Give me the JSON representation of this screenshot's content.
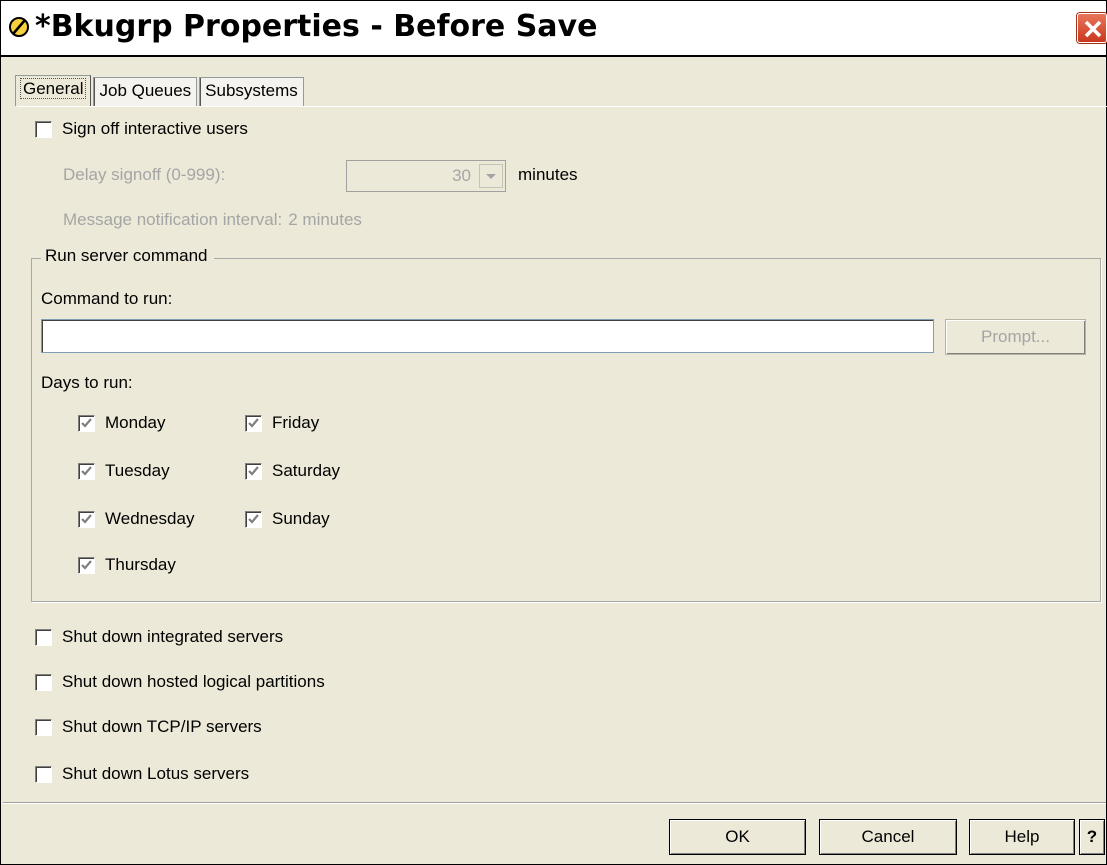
{
  "window": {
    "title": "*Bkugrp Properties - Before Save"
  },
  "tabs": [
    {
      "label": "General",
      "active": true
    },
    {
      "label": "Job Queues",
      "active": false
    },
    {
      "label": "Subsystems",
      "active": false
    }
  ],
  "general": {
    "sign_off": {
      "label": "Sign off interactive users",
      "checked": false
    },
    "delay_signoff": {
      "label": "Delay signoff (0-999):",
      "value": "30",
      "unit": "minutes"
    },
    "message_interval": {
      "label": "Message notification interval:",
      "value": "2 minutes"
    },
    "run_server_command": {
      "legend": "Run server command",
      "command_label": "Command to run:",
      "command_value": "",
      "prompt_button": "Prompt...",
      "days_label": "Days to run:",
      "days": [
        {
          "label": "Monday",
          "checked": true
        },
        {
          "label": "Tuesday",
          "checked": true
        },
        {
          "label": "Wednesday",
          "checked": true
        },
        {
          "label": "Thursday",
          "checked": true
        },
        {
          "label": "Friday",
          "checked": true
        },
        {
          "label": "Saturday",
          "checked": true
        },
        {
          "label": "Sunday",
          "checked": true
        }
      ]
    },
    "shutdown_options": [
      {
        "label": "Shut down integrated servers",
        "checked": false
      },
      {
        "label": "Shut down hosted logical partitions",
        "checked": false
      },
      {
        "label": "Shut down TCP/IP servers",
        "checked": false
      },
      {
        "label": "Shut down Lotus servers",
        "checked": false
      }
    ]
  },
  "footer": {
    "ok": "OK",
    "cancel": "Cancel",
    "help": "Help",
    "context_help": "?"
  },
  "colors": {
    "window_bg": "#ece9d8",
    "disabled_text": "#a5a5a5",
    "close_button": "#c8381e"
  }
}
